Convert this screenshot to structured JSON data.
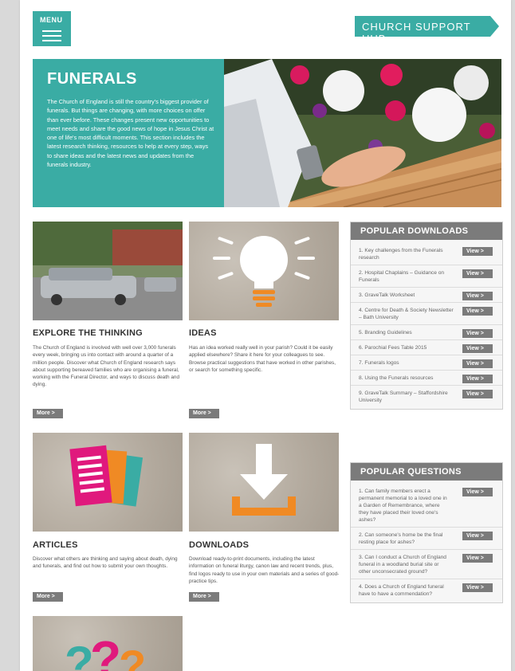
{
  "header": {
    "menu_label": "MENU",
    "hub_label": "CHURCH SUPPORT HUB"
  },
  "hero": {
    "title": "FUNERALS",
    "body": "The Church of England is still the country's biggest provider of funerals. But things are changing, with more choices on offer than ever before. These changes present new opportunities to meet needs and share the good news of hope in Jesus Christ at one of life's most difficult moments. This section includes the latest research thinking, resources to help at every step, ways to share ideas and the latest news and updates from the funerals industry."
  },
  "tiles": {
    "explore": {
      "title": "EXPLORE THE THINKING",
      "desc": "The Church of England is involved with well over 3,000 funerals every week, bringing us into contact with around a quarter of a million people. Discover what Church of England research says about supporting bereaved families who are organising a funeral, working with the Funeral Director, and ways to discuss death and dying.",
      "more": "More >"
    },
    "ideas": {
      "title": "IDEAS",
      "desc": "Has an idea worked really well in your parish? Could it be easily applied elsewhere? Share it here for your colleagues to see. Browse practical suggestions that have worked in other parishes, or search for something specific.",
      "more": "More >"
    },
    "articles": {
      "title": "ARTICLES",
      "desc": "Discover what others are thinking and saying about death, dying and funerals, and find out how to submit your own thoughts.",
      "more": "More >"
    },
    "downloads": {
      "title": "DOWNLOADS",
      "desc": "Download ready-to-print documents, including the latest information on funeral liturgy, canon law and recent trends, plus, find logos ready to use in your own materials and a series of good-practice tips.",
      "more": "More >"
    },
    "faq_glyphs": [
      "?",
      "?",
      "?"
    ]
  },
  "popular_downloads": {
    "title": "POPULAR DOWNLOADS",
    "view_label": "View >",
    "items": [
      "1.  Key challenges from the Funerals research",
      "2.  Hospital Chaplains – Guidance on Funerals",
      "3.  GraveTalk Worksheet",
      "4.  Centre for Death & Society Newsletter – Bath University",
      "5.  Branding Guidelines",
      "6.  Parochial Fees Table 2015",
      "7.  Funerals logos",
      "8.  Using the Funerals resources",
      "9.  GraveTalk Summary – Staffordshire University"
    ]
  },
  "popular_questions": {
    "title": "POPULAR QUESTIONS",
    "view_label": "View >",
    "items": [
      "1.  Can family members erect a permanent memorial to a loved one in a Garden of Remembrance, where they have placed their loved one's ashes?",
      "2.  Can someone's home be the final resting place for ashes?",
      "3.  Can I conduct a Church of England funeral in a woodland burial site or other unconsecrated ground?",
      "4.  Does a Church of England funeral have to have a commendation?"
    ]
  },
  "colors": {
    "teal": "#3aaca4",
    "grey_button": "#7b7b7b",
    "orange": "#f08a24",
    "magenta": "#e0197d"
  }
}
